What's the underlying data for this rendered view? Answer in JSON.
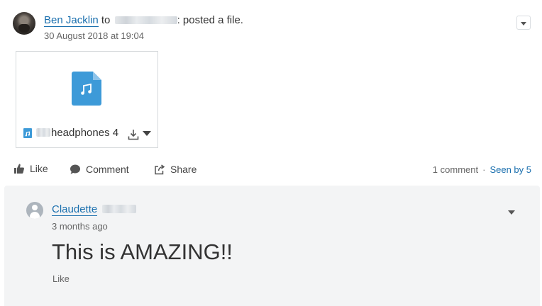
{
  "post": {
    "author": "Ben Jacklin",
    "to_word": "to",
    "action": ": posted a file.",
    "timestamp": "30 August 2018 at 19:04"
  },
  "file": {
    "name": "headphones 4"
  },
  "actions": {
    "like": "Like",
    "comment": "Comment",
    "share": "Share"
  },
  "stats": {
    "comments": "1 comment",
    "separator": "·",
    "seen": "Seen by 5"
  },
  "comment": {
    "author": "Claudette",
    "timestamp": "3 months ago",
    "body": "This is AMAZING!!",
    "like": "Like"
  },
  "icons": {
    "file_type": "music-file-icon",
    "download": "download-icon",
    "menu": "chevron-down-icon",
    "like": "thumbs-up-icon",
    "comment": "speech-bubble-icon",
    "share": "share-icon"
  },
  "colors": {
    "link": "#1a6fae",
    "file_icon": "#3d9ad8",
    "comment_panel_bg": "#f3f4f5"
  }
}
